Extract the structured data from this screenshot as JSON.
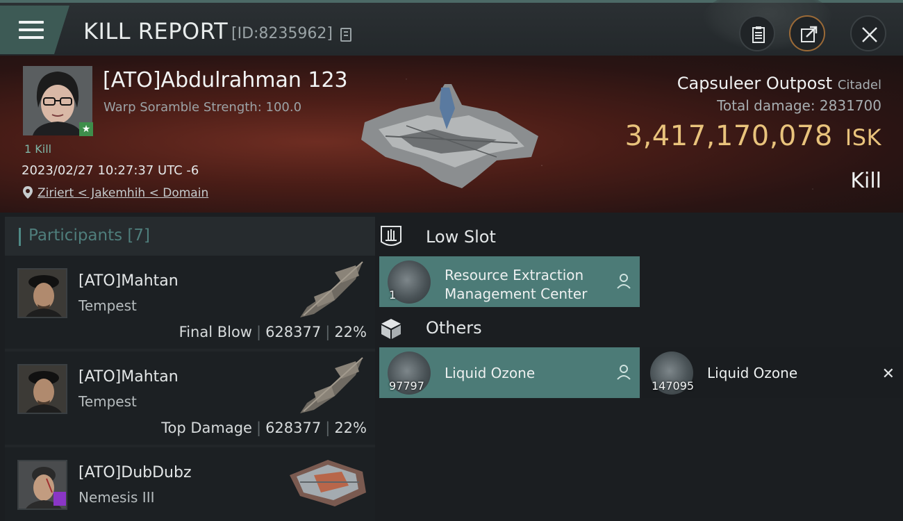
{
  "header": {
    "title": "KILL REPORT",
    "report_id": "[ID:8235962]"
  },
  "victim": {
    "name": "[ATO]Abdulrahman 123",
    "warp_scramble": "Warp Soramble Strength: 100.0",
    "kill_count_label": "1 Kill",
    "datetime": "2023/02/27 10:27:37 UTC -6",
    "location": "Ziriert < Jakemhih < Domain",
    "ship_name": "Capsuleer Outpost",
    "ship_class": "Citadel",
    "total_damage_label": "Total damage:",
    "total_damage_value": "2831700",
    "isk_value": "3,417,170,078",
    "isk_unit": "ISK",
    "result_label": "Kill"
  },
  "participants": {
    "title": "Participants",
    "count": "[7]",
    "items": [
      {
        "name": "[ATO]Mahtan",
        "ship": "Tempest",
        "role": "Final Blow",
        "damage": "628377",
        "percent": "22%"
      },
      {
        "name": "[ATO]Mahtan",
        "ship": "Tempest",
        "role": "Top Damage",
        "damage": "628377",
        "percent": "22%"
      },
      {
        "name": "[ATO]DubDubz",
        "ship": "Nemesis III",
        "role": "",
        "damage": "",
        "percent": ""
      }
    ]
  },
  "sections": {
    "low_slot": {
      "title": "Low Slot",
      "items": [
        {
          "name_line1": "Resource Extraction",
          "name_line2": "Management Center",
          "qty": "1"
        }
      ]
    },
    "others": {
      "title": "Others",
      "items": [
        {
          "name": "Liquid Ozone",
          "qty": "97797"
        },
        {
          "name": "Liquid Ozone",
          "qty": "147095"
        }
      ]
    }
  },
  "colors": {
    "accent_teal": "#4c7b77",
    "isk_gold": "#e9c37c",
    "banner_red": "#6e2d22"
  },
  "icons": [
    "menu-icon",
    "copy-icon",
    "clipboard-icon",
    "share-icon",
    "close-icon",
    "location-pin-icon",
    "person-icon",
    "low-slot-icon",
    "cube-icon",
    "x-icon",
    "star-icon"
  ]
}
